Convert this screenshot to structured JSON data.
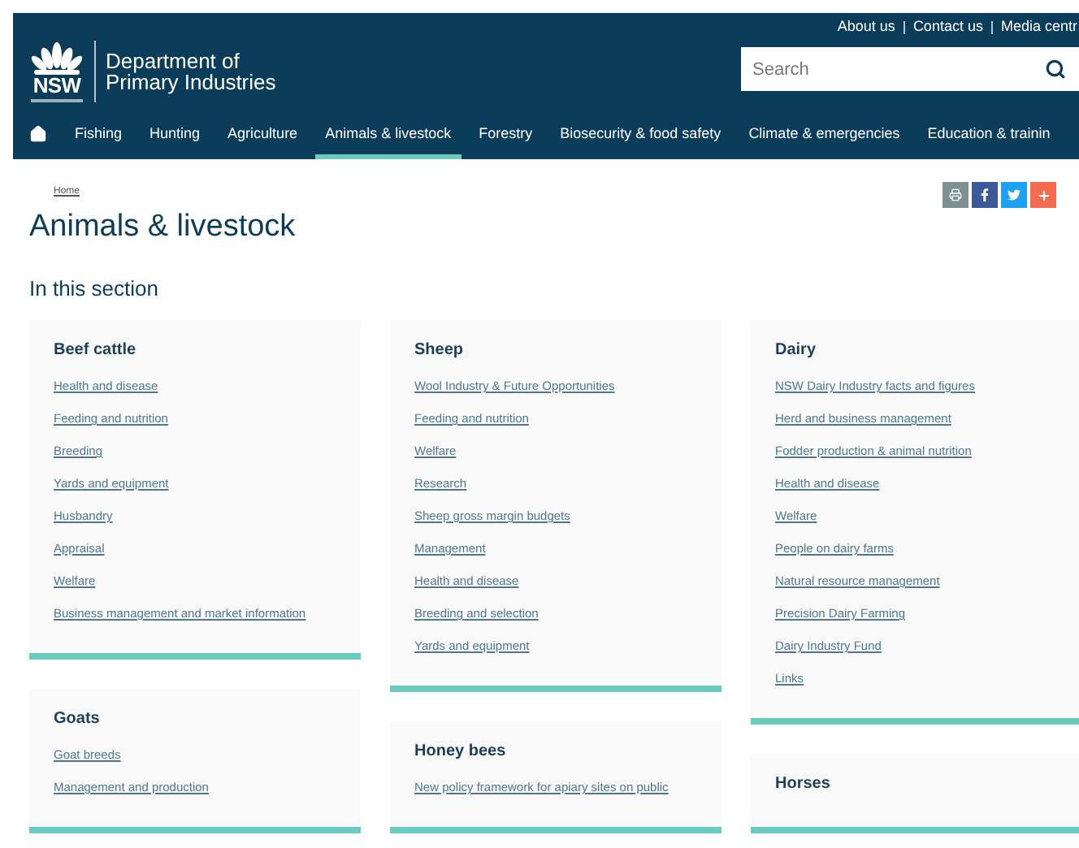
{
  "header": {
    "logo": {
      "mark": "NSW"
    },
    "site_title": [
      "Department of",
      "Primary Industries"
    ],
    "utility_links": [
      "About us",
      "Contact us",
      "Media centr"
    ],
    "search": {
      "placeholder": "Search"
    }
  },
  "nav": [
    {
      "kind": "home",
      "selected": false
    },
    {
      "kind": "link",
      "label": "Fishing",
      "selected": false
    },
    {
      "kind": "link",
      "label": "Hunting",
      "selected": false
    },
    {
      "kind": "link",
      "label": "Agriculture",
      "selected": false
    },
    {
      "kind": "link",
      "label": "Animals & livestock",
      "selected": true
    },
    {
      "kind": "link",
      "label": "Forestry",
      "selected": false
    },
    {
      "kind": "link",
      "label": "Biosecurity & food safety",
      "selected": false
    },
    {
      "kind": "link",
      "label": "Climate & emergencies",
      "selected": false
    },
    {
      "kind": "link",
      "label": "Education & trainin",
      "selected": false
    }
  ],
  "breadcrumb": [
    "Home"
  ],
  "share_buttons": [
    {
      "kind": "print"
    },
    {
      "kind": "facebook"
    },
    {
      "kind": "twitter"
    },
    {
      "kind": "more"
    }
  ],
  "title": "Animals & livestock",
  "section_heading": "In this section",
  "columns": [
    [
      {
        "title": "Beef cattle",
        "links": [
          "Health and disease",
          "Feeding and nutrition",
          "Breeding",
          "Yards and equipment",
          "Husbandry",
          "Appraisal",
          "Welfare",
          "Business management and market information"
        ]
      },
      {
        "title": "Goats",
        "links": [
          "Goat breeds",
          "Management and production"
        ]
      }
    ],
    [
      {
        "title": "Sheep",
        "links": [
          "Wool Industry & Future Opportunities",
          "Feeding and nutrition",
          "Welfare",
          "Research",
          "Sheep gross margin budgets",
          "Management",
          "Health and disease",
          "Breeding and selection",
          "Yards and equipment"
        ]
      },
      {
        "title": "Honey bees",
        "links": [
          "New policy framework for apiary sites on public"
        ]
      }
    ],
    [
      {
        "title": "Dairy",
        "links": [
          "NSW Dairy Industry facts and figures",
          "Herd and business management",
          "Fodder production & animal nutrition",
          "Health and disease",
          "Welfare",
          "People on dairy farms",
          "Natural resource management",
          "Precision Dairy Farming",
          "Dairy Industry Fund",
          "Links"
        ]
      },
      {
        "title": "Horses"
      }
    ]
  ]
}
